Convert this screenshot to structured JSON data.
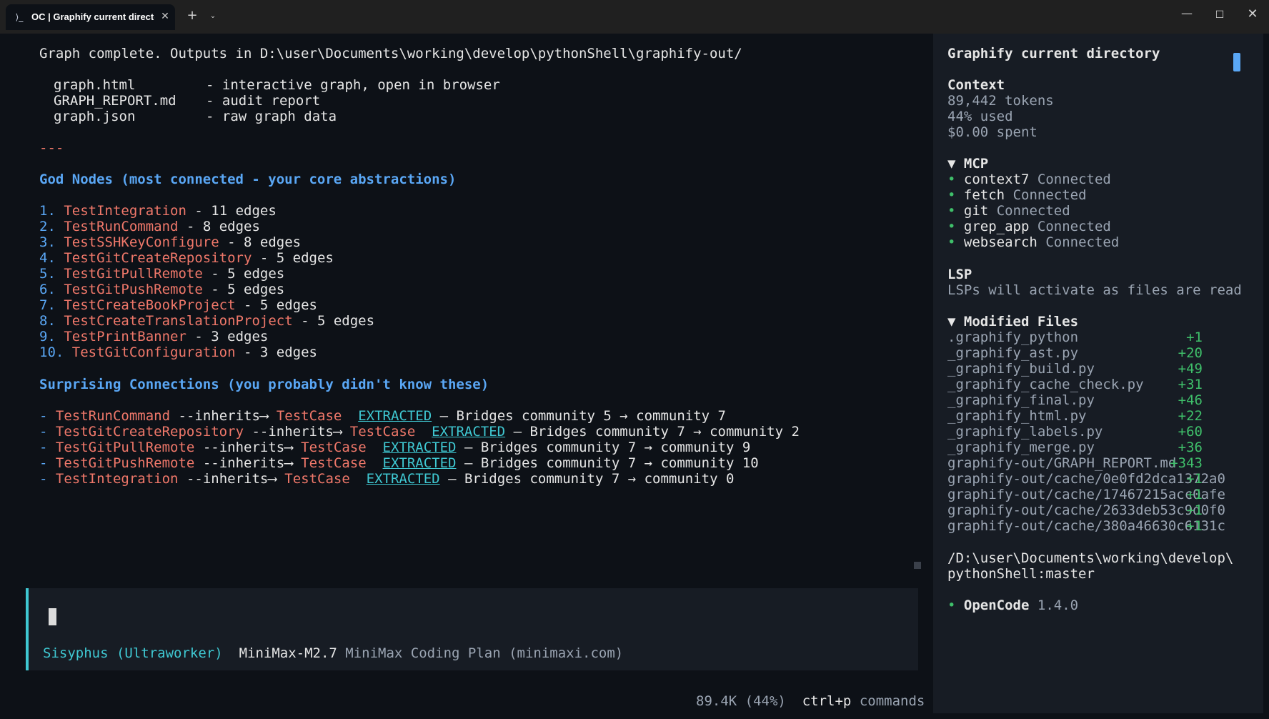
{
  "window": {
    "tab_icon": "terminal-icon",
    "tab_icon_glyph": "⟩_",
    "tab_title": "OC | Graphify current directory",
    "tab_close": "✕",
    "new_tab": "+",
    "tab_dropdown": "⌄",
    "minimize": "—",
    "maximize": "☐",
    "close": "✕"
  },
  "main": {
    "graph_complete": "Graph complete. Outputs in D:\\user\\Documents\\working\\develop\\pythonShell\\graphify-out/",
    "outputs": [
      {
        "file": "graph.html",
        "desc": "- interactive graph, open in browser"
      },
      {
        "file": "GRAPH_REPORT.md",
        "desc": "- audit report"
      },
      {
        "file": "graph.json",
        "desc": "- raw graph data"
      }
    ],
    "separator": "---",
    "god_nodes_heading": "God Nodes (most connected - your core abstractions)",
    "god_nodes": [
      {
        "num": "1.",
        "name": "TestIntegration",
        "edges": "- 11 edges"
      },
      {
        "num": "2.",
        "name": "TestRunCommand",
        "edges": "- 8 edges"
      },
      {
        "num": "3.",
        "name": "TestSSHKeyConfigure",
        "edges": "- 8 edges"
      },
      {
        "num": "4.",
        "name": "TestGitCreateRepository",
        "edges": "- 5 edges"
      },
      {
        "num": "5.",
        "name": "TestGitPullRemote",
        "edges": "- 5 edges"
      },
      {
        "num": "6.",
        "name": "TestGitPushRemote",
        "edges": "- 5 edges"
      },
      {
        "num": "7.",
        "name": "TestCreateBookProject",
        "edges": "- 5 edges"
      },
      {
        "num": "8.",
        "name": "TestCreateTranslationProject",
        "edges": "- 5 edges"
      },
      {
        "num": "9.",
        "name": "TestPrintBanner",
        "edges": "- 3 edges"
      },
      {
        "num": "10.",
        "name": "TestGitConfiguration",
        "edges": "- 3 edges"
      }
    ],
    "surprising_heading": "Surprising Connections (you probably didn't know these)",
    "connections": [
      {
        "dash": "-",
        "source": "TestRunCommand",
        "relation": "--inherits⟶",
        "target": "TestCase",
        "tag": "EXTRACTED",
        "desc": "— Bridges community 5 → community 7"
      },
      {
        "dash": "-",
        "source": "TestGitCreateRepository",
        "relation": "--inherits⟶",
        "target": "TestCase",
        "tag": "EXTRACTED",
        "desc": "— Bridges community 7 → community 2"
      },
      {
        "dash": "-",
        "source": "TestGitPullRemote",
        "relation": "--inherits⟶",
        "target": "TestCase",
        "tag": "EXTRACTED",
        "desc": "— Bridges community 7 → community 9"
      },
      {
        "dash": "-",
        "source": "TestGitPushRemote",
        "relation": "--inherits⟶",
        "target": "TestCase",
        "tag": "EXTRACTED",
        "desc": "— Bridges community 7 → community 10"
      },
      {
        "dash": "-",
        "source": "TestIntegration",
        "relation": "--inherits⟶",
        "target": "TestCase",
        "tag": "EXTRACTED",
        "desc": "— Bridges community 7 → community 0"
      }
    ]
  },
  "prompt": {
    "agent": "Sisyphus (Ultraworker)",
    "model": "MiniMax-M2.7",
    "provider": "MiniMax Coding Plan (minimaxi.com)"
  },
  "status": {
    "tokens": "89.4K (44%)",
    "shortcut": "ctrl+p",
    "shortcut_label": "commands"
  },
  "sidebar": {
    "title": "Graphify current directory",
    "context_heading": "Context",
    "tokens": "89,442 tokens",
    "used": "44% used",
    "spent": "$0.00 spent",
    "mcp_heading": "▼ MCP",
    "mcp": [
      {
        "name": "context7",
        "status": "Connected"
      },
      {
        "name": "fetch",
        "status": "Connected"
      },
      {
        "name": "git",
        "status": "Connected"
      },
      {
        "name": "grep_app",
        "status": "Connected"
      },
      {
        "name": "websearch",
        "status": "Connected"
      }
    ],
    "bullet": "•",
    "lsp_heading": "LSP",
    "lsp_text": "LSPs will activate as files are read",
    "modified_heading": "▼ Modified Files",
    "files": [
      {
        "name": ".graphify_python",
        "diff": "+1"
      },
      {
        "name": "_graphify_ast.py",
        "diff": "+20"
      },
      {
        "name": "_graphify_build.py",
        "diff": "+49"
      },
      {
        "name": "_graphify_cache_check.py",
        "diff": "+31"
      },
      {
        "name": "_graphify_final.py",
        "diff": "+46"
      },
      {
        "name": "_graphify_html.py",
        "diff": "+22"
      },
      {
        "name": "_graphify_labels.py",
        "diff": "+60"
      },
      {
        "name": "_graphify_merge.py",
        "diff": "+36"
      },
      {
        "name": "graphify-out/GRAPH_REPORT.md",
        "diff": "+343"
      },
      {
        "name": "graphify-out/cache/0e0fd2dca1372a0",
        "diff": "+1"
      },
      {
        "name": "graphify-out/cache/17467215acc0afe",
        "diff": "+1"
      },
      {
        "name": "graphify-out/cache/2633deb53c9d0f0",
        "diff": "+1"
      },
      {
        "name": "graphify-out/cache/380a46630c6131c",
        "diff": "+1"
      }
    ],
    "path_line1": "/D:\\user\\Documents\\working\\develop\\",
    "path_line2": "pythonShell:master",
    "app_name": "OpenCode",
    "app_version": "1.4.0"
  }
}
